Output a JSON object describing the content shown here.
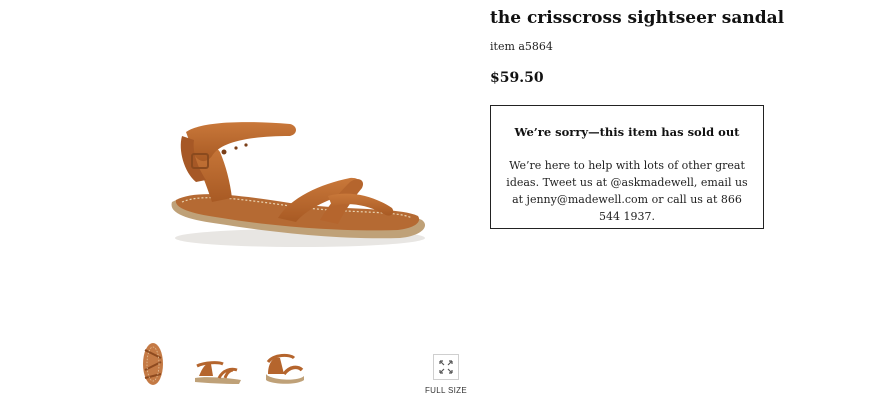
{
  "product": {
    "title": "the crisscross sightseer sandal",
    "item_number": "item a5864",
    "price": "$59.50"
  },
  "availability": {
    "heading": "We’re sorry—this item has sold out",
    "message": "We’re here to help with lots of other great ideas. Tweet us at @askmadewell, email us at jenny@madewell.com or call us at 866 544 1937."
  },
  "gallery": {
    "thumbnail_icons": [
      "sandal-top-view",
      "sandal-side-view",
      "sandal-back-view"
    ],
    "full_size_label": "FULL SIZE",
    "full_size_icon": "expand-arrows-icon"
  },
  "colors": {
    "leather": "#b8672e",
    "sole": "#b89a6e",
    "border": "#222222"
  }
}
